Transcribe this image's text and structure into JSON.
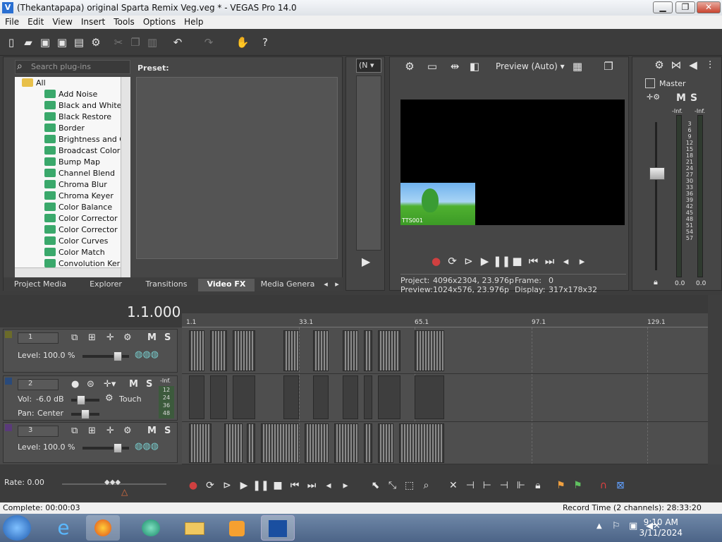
{
  "window": {
    "title": "(Thekantapapa) original Sparta Remix Veg.veg * - VEGAS Pro 14.0",
    "app_icon": "V",
    "min": "▁",
    "max": "❐",
    "close": "✕"
  },
  "menu": [
    "File",
    "Edit",
    "View",
    "Insert",
    "Tools",
    "Options",
    "Help"
  ],
  "fx": {
    "search_placeholder": "Search plug-ins",
    "tree_root": "All",
    "items": [
      "Add Noise",
      "Black and White",
      "Black Restore",
      "Border",
      "Brightness and Co",
      "Broadcast Colors",
      "Bump Map",
      "Channel Blend",
      "Chroma Blur",
      "Chroma Keyer",
      "Color Balance",
      "Color Corrector",
      "Color Corrector (S",
      "Color Curves",
      "Color Match",
      "Convolution Kerne"
    ],
    "preset_label": "Preset:",
    "tabs": [
      "Project Media",
      "Explorer",
      "Transitions",
      "Video FX",
      "Media Genera"
    ],
    "active_tab": "Video FX"
  },
  "trimmer": {
    "selector": "(N"
  },
  "preview": {
    "quality": "Preview (Auto)",
    "thumb_text": "TTS001",
    "project_label": "Project:",
    "project_value": "4096x2304, 23.976p",
    "preview_label": "Preview:",
    "preview_value": "1024x576, 23.976p",
    "frame_label": "Frame:",
    "frame_value": "0",
    "display_label": "Display:",
    "display_value": "317x178x32"
  },
  "mixer": {
    "master": "Master",
    "inf_left": "-Inf.",
    "inf_right": "-Inf.",
    "scale": [
      "3",
      "6",
      "9",
      "12",
      "15",
      "18",
      "21",
      "24",
      "27",
      "30",
      "33",
      "36",
      "39",
      "42",
      "45",
      "48",
      "51",
      "54",
      "57"
    ],
    "bottom_left": "0.0",
    "bottom_right": "0.0"
  },
  "timeline": {
    "timecode": "1.1.000",
    "ruler": [
      "1.1",
      "33.1",
      "65.1",
      "97.1",
      "129.1"
    ]
  },
  "tracks": [
    {
      "num": "1",
      "label": "Level:",
      "value": "100.0 %"
    },
    {
      "num": "2",
      "vol_label": "Vol:",
      "vol_value": "-6.0 dB",
      "pan_label": "Pan:",
      "pan_value": "Center",
      "mode": "Touch",
      "meter_top": "-Inf.",
      "meter_vals": [
        "12",
        "24",
        "36",
        "48"
      ]
    },
    {
      "num": "3",
      "label": "Level:",
      "value": "100.0 %"
    }
  ],
  "bottom": {
    "rate": "Rate: 0.00"
  },
  "status": {
    "left": "Complete: 00:00:03",
    "right": "Record Time (2 channels): 28:33:20"
  },
  "taskbar": {
    "time": "9:10 AM",
    "date": "3/11/2024"
  },
  "colors": {
    "accent": "#2a6fd1",
    "track1": "#6b6b2a",
    "track2": "#2a4a7a",
    "track3": "#5a3a7a"
  }
}
